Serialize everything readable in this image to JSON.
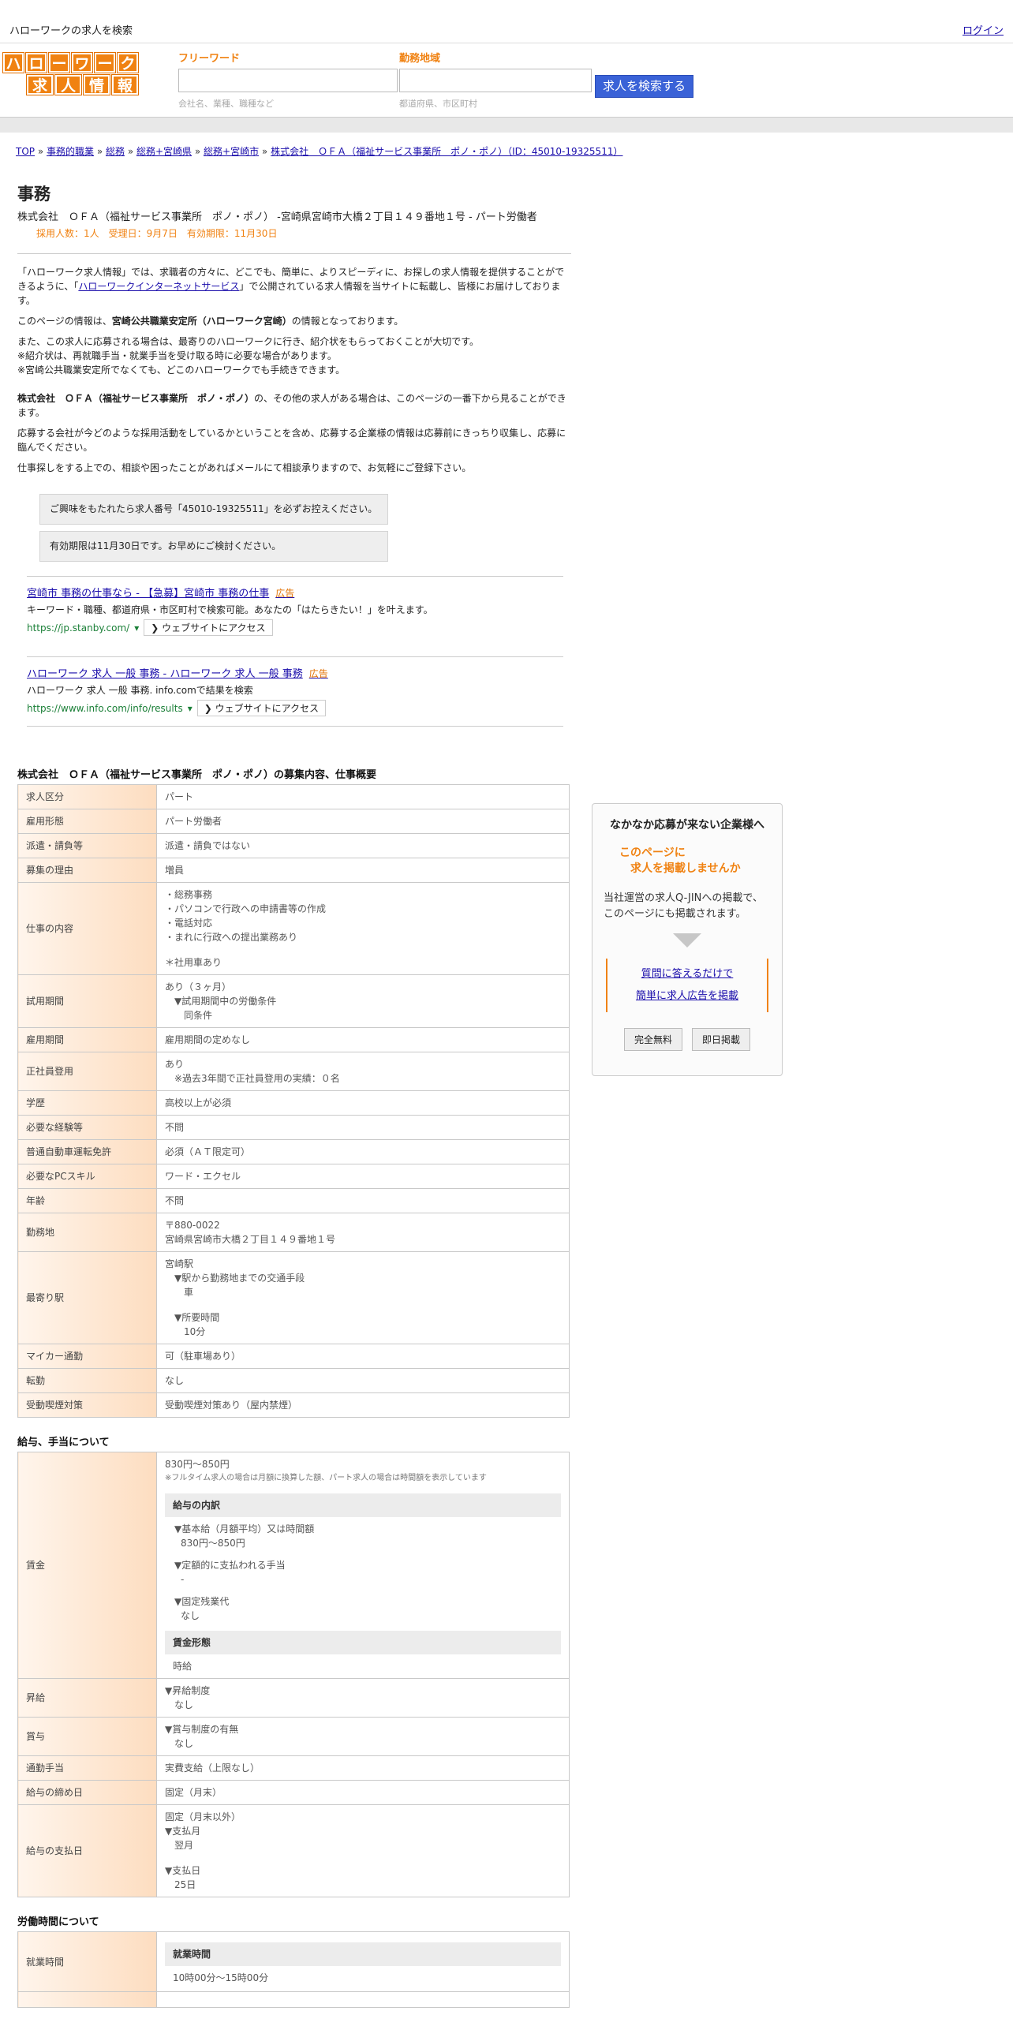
{
  "topbar": {
    "site_title": "ハローワークの求人を検索",
    "login": "ログイン"
  },
  "logo": {
    "row1": [
      "ハ",
      "ロ",
      "ー",
      "ワ",
      "ー",
      "ク"
    ],
    "row2": [
      "求",
      "人",
      "情",
      "報"
    ]
  },
  "search": {
    "keyword_label": "フリーワード",
    "keyword_placeholder": "会社名、業種、職種など",
    "area_label": "勤務地域",
    "area_placeholder": "都道府県、市区町村",
    "button": "求人を検索する"
  },
  "breadcrumb": [
    "TOP",
    "事務的職業",
    "総務",
    "総務+宮崎県",
    "総務+宮崎市",
    "株式会社　ＯＦＡ（福祉サービス事業所　ポノ・ポノ）（ID：45010-19325511）"
  ],
  "job": {
    "title": "事務",
    "subtitle": "株式会社　ＯＦＡ（福祉サービス事業所　ポノ・ポノ） -宮崎県宮崎市大橋２丁目１４９番地１号 - パート労働者",
    "meta": "採用人数：1人　受理日：9月7日　有効期限：11月30日"
  },
  "intro": {
    "p1a": "「ハローワーク求人情報」では、求職者の方々に、どこでも、簡単に、よりスピーディに、お探しの求人情報を提供することができるように、「",
    "p1link": "ハローワークインターネットサービス",
    "p1b": "」で公開されている求人情報を当サイトに転載し、皆様にお届けしております。",
    "p2a": "このページの情報は、",
    "p2b": "宮崎公共職業安定所（ハローワーク宮崎）",
    "p2c": "の情報となっております。",
    "p3l1": "また、この求人に応募される場合は、最寄りのハローワークに行き、紹介状をもらっておくことが大切です。",
    "p3l2": "※紹介状は、再就職手当・就業手当を受け取る時に必要な場合があります。",
    "p3l3": "※宮崎公共職業安定所でなくても、どこのハローワークでも手続きできます。",
    "p4a": "株式会社　ＯＦＡ（福祉サービス事業所　ポノ・ポノ）",
    "p4b": "の、その他の求人がある場合は、このページの一番下から見ることができます。",
    "p5": "応募する会社が今どのような採用活動をしているかということを含め、応募する企業様の情報は応募前にきっちり収集し、応募に臨んでください。",
    "p6": "仕事探しをする上での、相談や困ったことがあればメールにて相談承りますので、お気軽にご登録下さい。"
  },
  "notices": [
    "ご興味をもたれたら求人番号「45010-19325511」を必ずお控えください。",
    "有効期限は11月30日です。お早めにご検討ください。"
  ],
  "ads": [
    {
      "title": "宮崎市 事務の仕事なら - 【急募】宮崎市 事務の仕事",
      "tag": "広告",
      "desc": "キーワード・職種、都道府県・市区町村で検索可能。あなたの「はたらきたい！」を叶えます。",
      "url": "https://jp.stanby.com/",
      "visit": "❯ ウェブサイトにアクセス"
    },
    {
      "title": "ハローワーク 求人 一般 事務 - ハローワーク 求人 一般 事務",
      "tag": "広告",
      "desc": "ハローワーク 求人 一般 事務. info.comで結果を検索",
      "url": "https://www.info.com/info/results",
      "visit": "❯ ウェブサイトにアクセス"
    }
  ],
  "section1": {
    "title": "株式会社　ＯＦＡ（福祉サービス事業所　ポノ・ポノ）の募集内容、仕事概要",
    "rows": [
      {
        "h": "求人区分",
        "v": [
          "パート"
        ]
      },
      {
        "h": "雇用形態",
        "v": [
          "パート労働者"
        ]
      },
      {
        "h": "派遣・請負等",
        "v": [
          "派遣・請負ではない"
        ]
      },
      {
        "h": "募集の理由",
        "v": [
          "増員"
        ]
      },
      {
        "h": "仕事の内容",
        "v": [
          "・総務事務",
          "・パソコンで行政への申請書等の作成",
          "・電話対応",
          "・まれに行政への提出業務あり",
          "",
          "＊社用車あり"
        ]
      },
      {
        "h": "試用期間",
        "v": [
          "あり（３ヶ月）",
          "　▼試用期間中の労働条件",
          "　　同条件"
        ]
      },
      {
        "h": "雇用期間",
        "v": [
          "雇用期間の定めなし"
        ]
      },
      {
        "h": "正社員登用",
        "v": [
          "あり",
          "　※過去3年間で正社員登用の実績：０名"
        ]
      },
      {
        "h": "学歴",
        "v": [
          "高校以上が必須"
        ]
      },
      {
        "h": "必要な経験等",
        "v": [
          "不問"
        ]
      },
      {
        "h": "普通自動車運転免許",
        "v": [
          "必須（ＡＴ限定可）"
        ]
      },
      {
        "h": "必要なPCスキル",
        "v": [
          "ワード・エクセル"
        ]
      },
      {
        "h": "年齢",
        "v": [
          "不問"
        ]
      },
      {
        "h": "勤務地",
        "v": [
          "〒880-0022",
          "宮崎県宮崎市大橋２丁目１４９番地１号"
        ]
      },
      {
        "h": "最寄り駅",
        "v": [
          "宮崎駅",
          "　▼駅から勤務地までの交通手段",
          "　　車",
          "",
          "　▼所要時間",
          "　　10分"
        ]
      },
      {
        "h": "マイカー通勤",
        "v": [
          "可（駐車場あり）"
        ]
      },
      {
        "h": "転勤",
        "v": [
          "なし"
        ]
      },
      {
        "h": "受動喫煙対策",
        "v": [
          "受動喫煙対策あり（屋内禁煙）"
        ]
      }
    ]
  },
  "section2": {
    "title": "給与、手当について",
    "wage": {
      "h": "賃金",
      "amount": "830円〜850円",
      "note": "※フルタイム求人の場合は月額に換算した額、パート求人の場合は時間額を表示しています",
      "breakdown_title": "給与の内訳",
      "base_label": "▼基本給（月額平均）又は時間額",
      "base_value": "830円〜850円",
      "fixed_label": "▼定額的に支払われる手当",
      "fixed_value": "-",
      "overtime_label": "▼固定残業代",
      "overtime_value": "なし",
      "form_title": "賃金形態",
      "form_value": "時給"
    },
    "rows": [
      {
        "h": "昇給",
        "v": [
          "▼昇給制度",
          "　なし"
        ]
      },
      {
        "h": "賞与",
        "v": [
          "▼賞与制度の有無",
          "　なし"
        ]
      },
      {
        "h": "通勤手当",
        "v": [
          "実費支給（上限なし）"
        ]
      },
      {
        "h": "給与の締め日",
        "v": [
          "固定（月末）"
        ]
      },
      {
        "h": "給与の支払日",
        "v": [
          "固定（月末以外）",
          "▼支払月",
          "　翌月",
          "",
          "▼支払日",
          "　25日"
        ]
      }
    ]
  },
  "section3": {
    "title": "労働時間について",
    "row_h": "就業時間",
    "box_title": "就業時間",
    "box_value": "10時00分〜15時00分"
  },
  "sidebar": {
    "t1": "なかなか応募が来ない企業様へ",
    "t2a": "このページに",
    "t2b": "　求人を掲載しませんか",
    "t3a": "当社運営の求人Q-JINへの掲載で、",
    "t3b": "このページにも掲載されます。",
    "link1": "質問に答えるだけで",
    "link2": "簡単に求人広告を掲載",
    "btn1": "完全無料",
    "btn2": "即日掲載"
  }
}
